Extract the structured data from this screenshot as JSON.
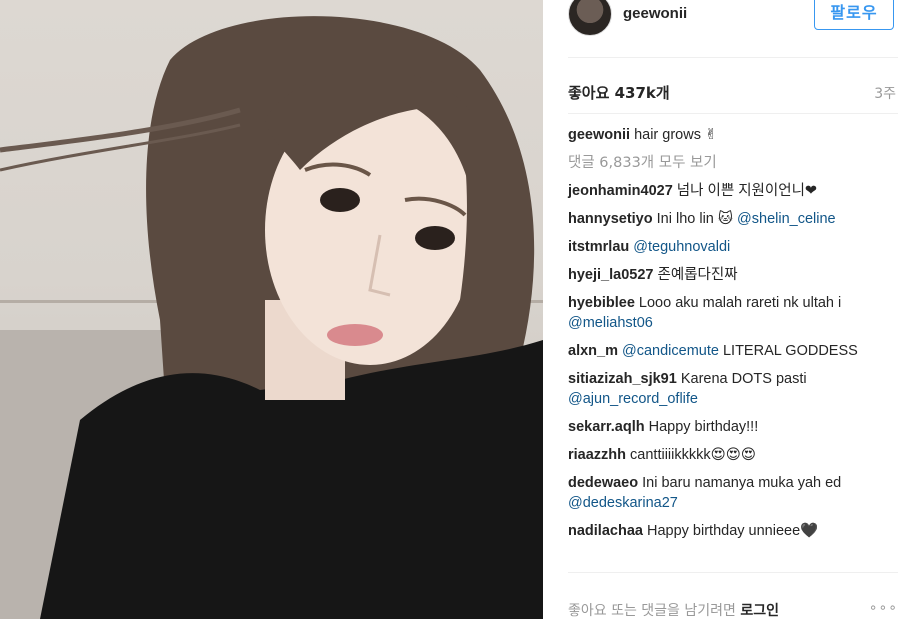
{
  "post": {
    "username": "geewonii",
    "follow_label": "팔로우",
    "likes": "좋아요 437k개",
    "time": "3주",
    "caption_user": "geewonii",
    "caption_text": "hair grows ✌",
    "view_all": "댓글 6,833개 모두 보기"
  },
  "comments": [
    {
      "user": "jeonhamin4027",
      "text": "넘나 이쁜 지원이언니❤",
      "mention": ""
    },
    {
      "user": "hannysetiyo",
      "text": "Ini lho lin 🐱",
      "mention": "@shelin_celine"
    },
    {
      "user": "itstmrlau",
      "text": "",
      "mention": "@teguhnovaldi"
    },
    {
      "user": "hyeji_la0527",
      "text": "존예롭다진짜",
      "mention": ""
    },
    {
      "user": "hyebiblee",
      "text": "Looo aku malah rareti nk ultah i",
      "mention": "@meliahst06"
    },
    {
      "user": "alxn_m",
      "text": "",
      "mention": "@candicemute",
      "after": " LITERAL GODDESS"
    },
    {
      "user": "sitiazizah_sjk91",
      "text": "Karena DOTS pasti",
      "mention": "@ajun_record_oflife"
    },
    {
      "user": "sekarr.aqlh",
      "text": "Happy birthday!!!",
      "mention": ""
    },
    {
      "user": "riaazzhh",
      "text": "canttiiiikkkkk😍😍😍",
      "mention": ""
    },
    {
      "user": "dedewaeo",
      "text": "Ini baru namanya muka yah ed",
      "mention": "@dedeskarina27"
    },
    {
      "user": "nadilachaa",
      "text": "Happy birthday unnieee🖤",
      "mention": ""
    }
  ],
  "footer": {
    "prompt": "좋아요 또는 댓글을 남기려면 ",
    "login": "로그인",
    "more_icon": "more-options-icon"
  }
}
